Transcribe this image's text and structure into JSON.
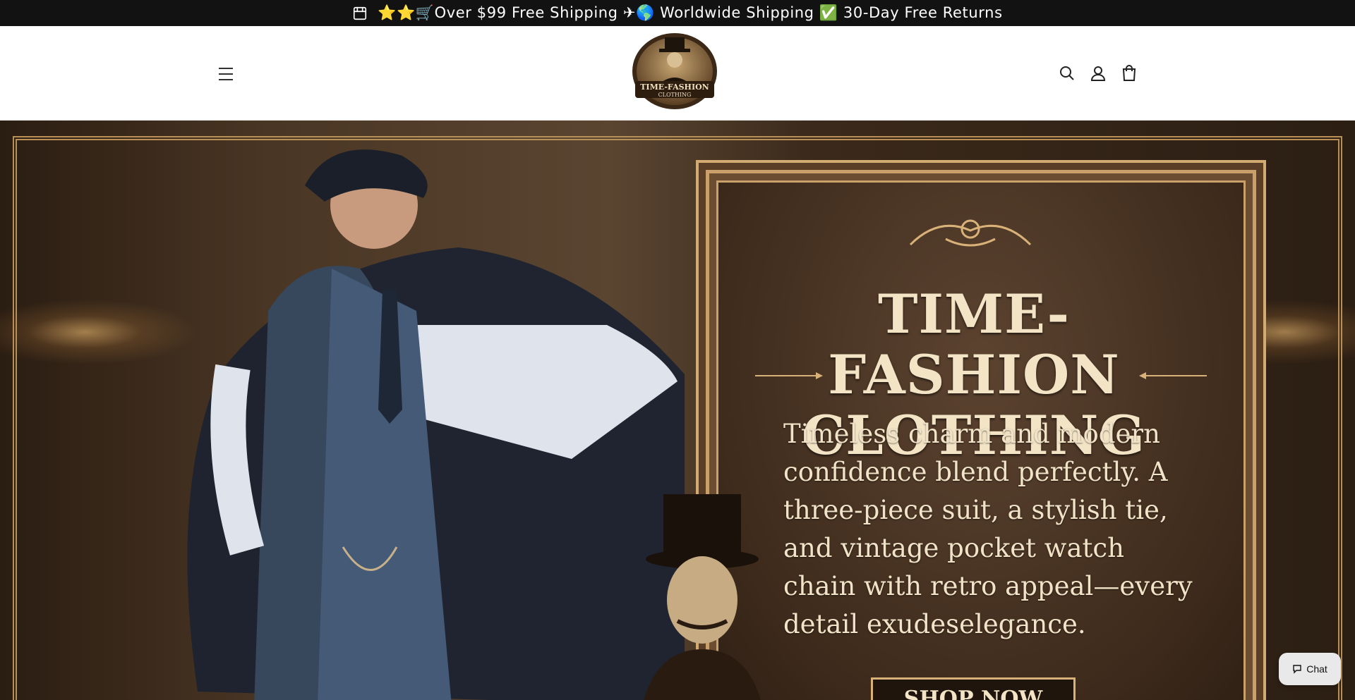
{
  "announcement": {
    "text": "⭐⭐🛒Over $99 Free Shipping ✈🌎 Worldwide Shipping ✅ 30-Day Free Returns",
    "icon": "store-icon"
  },
  "header": {
    "menu_icon": "hamburger-menu-icon",
    "logo": {
      "line1": "TIME-FASHION",
      "line2": "CLOTHING"
    },
    "icons": [
      "search-icon",
      "account-icon",
      "cart-icon"
    ]
  },
  "hero": {
    "title_line1": "TIME-FASHION",
    "title_line2": "CLOTHING",
    "description": "Timeless charm and modern confidence blend perfectly. A three-piece suit, a stylish tie, and vintage pocket watch chain with retro appeal—every detail exudeselegance.",
    "button_label": "SHOP NOW"
  },
  "chat": {
    "label": "Chat",
    "icon": "chat-bubble-icon"
  },
  "colors": {
    "announce_bg": "#121212",
    "accent_gold": "#c9a06a",
    "hero_text": "#f3e4c6"
  }
}
